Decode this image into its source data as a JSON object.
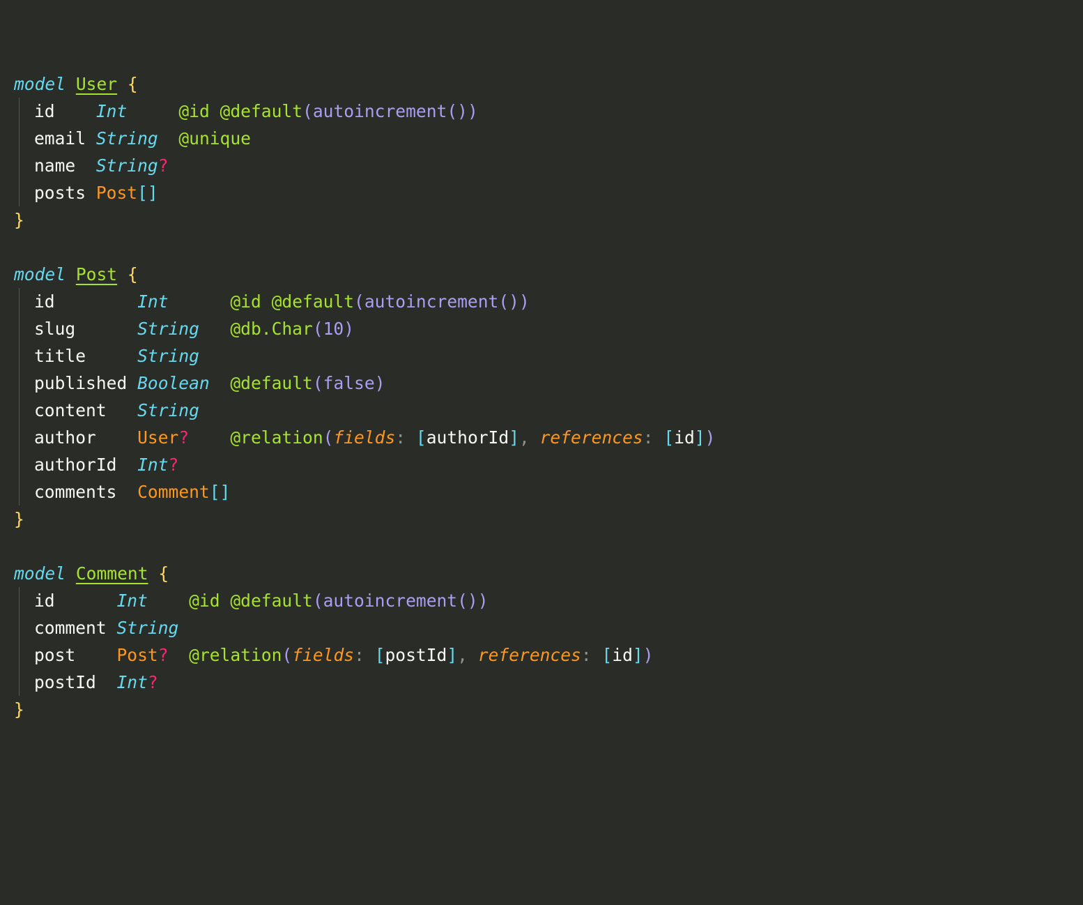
{
  "kw": "model",
  "open": "{",
  "close": "}",
  "q": "?",
  "lsq": "[",
  "rsq": "]",
  "lp": "(",
  "rp": ")",
  "colon": ":",
  "comma": ",",
  "models": {
    "user": {
      "name": "User",
      "fields": {
        "id": {
          "name": "id",
          "type": "Int",
          "attr": "@id @default",
          "fn": "autoincrement()"
        },
        "email": {
          "name": "email",
          "type": "String",
          "attr": "@unique"
        },
        "uname": {
          "name": "name",
          "type": "String"
        },
        "posts": {
          "name": "posts",
          "ref": "Post"
        }
      }
    },
    "post": {
      "name": "Post",
      "fields": {
        "id": {
          "name": "id",
          "type": "Int",
          "attr": "@id @default",
          "fn": "autoincrement()"
        },
        "slug": {
          "name": "slug",
          "type": "String",
          "attr": "@db.Char",
          "arg": "10"
        },
        "title": {
          "name": "title",
          "type": "String"
        },
        "published": {
          "name": "published",
          "type": "Boolean",
          "attr": "@default",
          "arg": "false"
        },
        "content": {
          "name": "content",
          "type": "String"
        },
        "author": {
          "name": "author",
          "ref": "User",
          "attr": "@relation",
          "k1": "fields",
          "v1": "authorId",
          "k2": "references",
          "v2": "id"
        },
        "authorId": {
          "name": "authorId",
          "type": "Int"
        },
        "comments": {
          "name": "comments",
          "ref": "Comment"
        }
      }
    },
    "comment": {
      "name": "Comment",
      "fields": {
        "id": {
          "name": "id",
          "type": "Int",
          "attr": "@id @default",
          "fn": "autoincrement()"
        },
        "cmt": {
          "name": "comment",
          "type": "String"
        },
        "post": {
          "name": "post",
          "ref": "Post",
          "attr": "@relation",
          "k1": "fields",
          "v1": "postId",
          "k2": "references",
          "v2": "id"
        },
        "postId": {
          "name": "postId",
          "type": "Int"
        }
      }
    }
  }
}
